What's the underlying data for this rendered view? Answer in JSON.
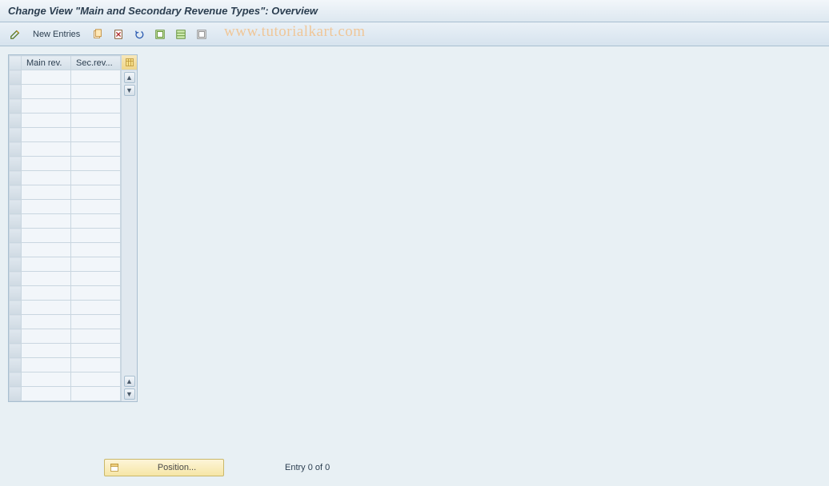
{
  "header": {
    "title": "Change View \"Main and Secondary Revenue Types\": Overview"
  },
  "toolbar": {
    "new_entries_label": "New Entries"
  },
  "table": {
    "columns": {
      "main": "Main rev.",
      "sec": "Sec.rev..."
    },
    "row_count": 23
  },
  "footer": {
    "position_label": "Position...",
    "entry_status": "Entry 0 of 0"
  },
  "watermark": "www.tutorialkart.com"
}
